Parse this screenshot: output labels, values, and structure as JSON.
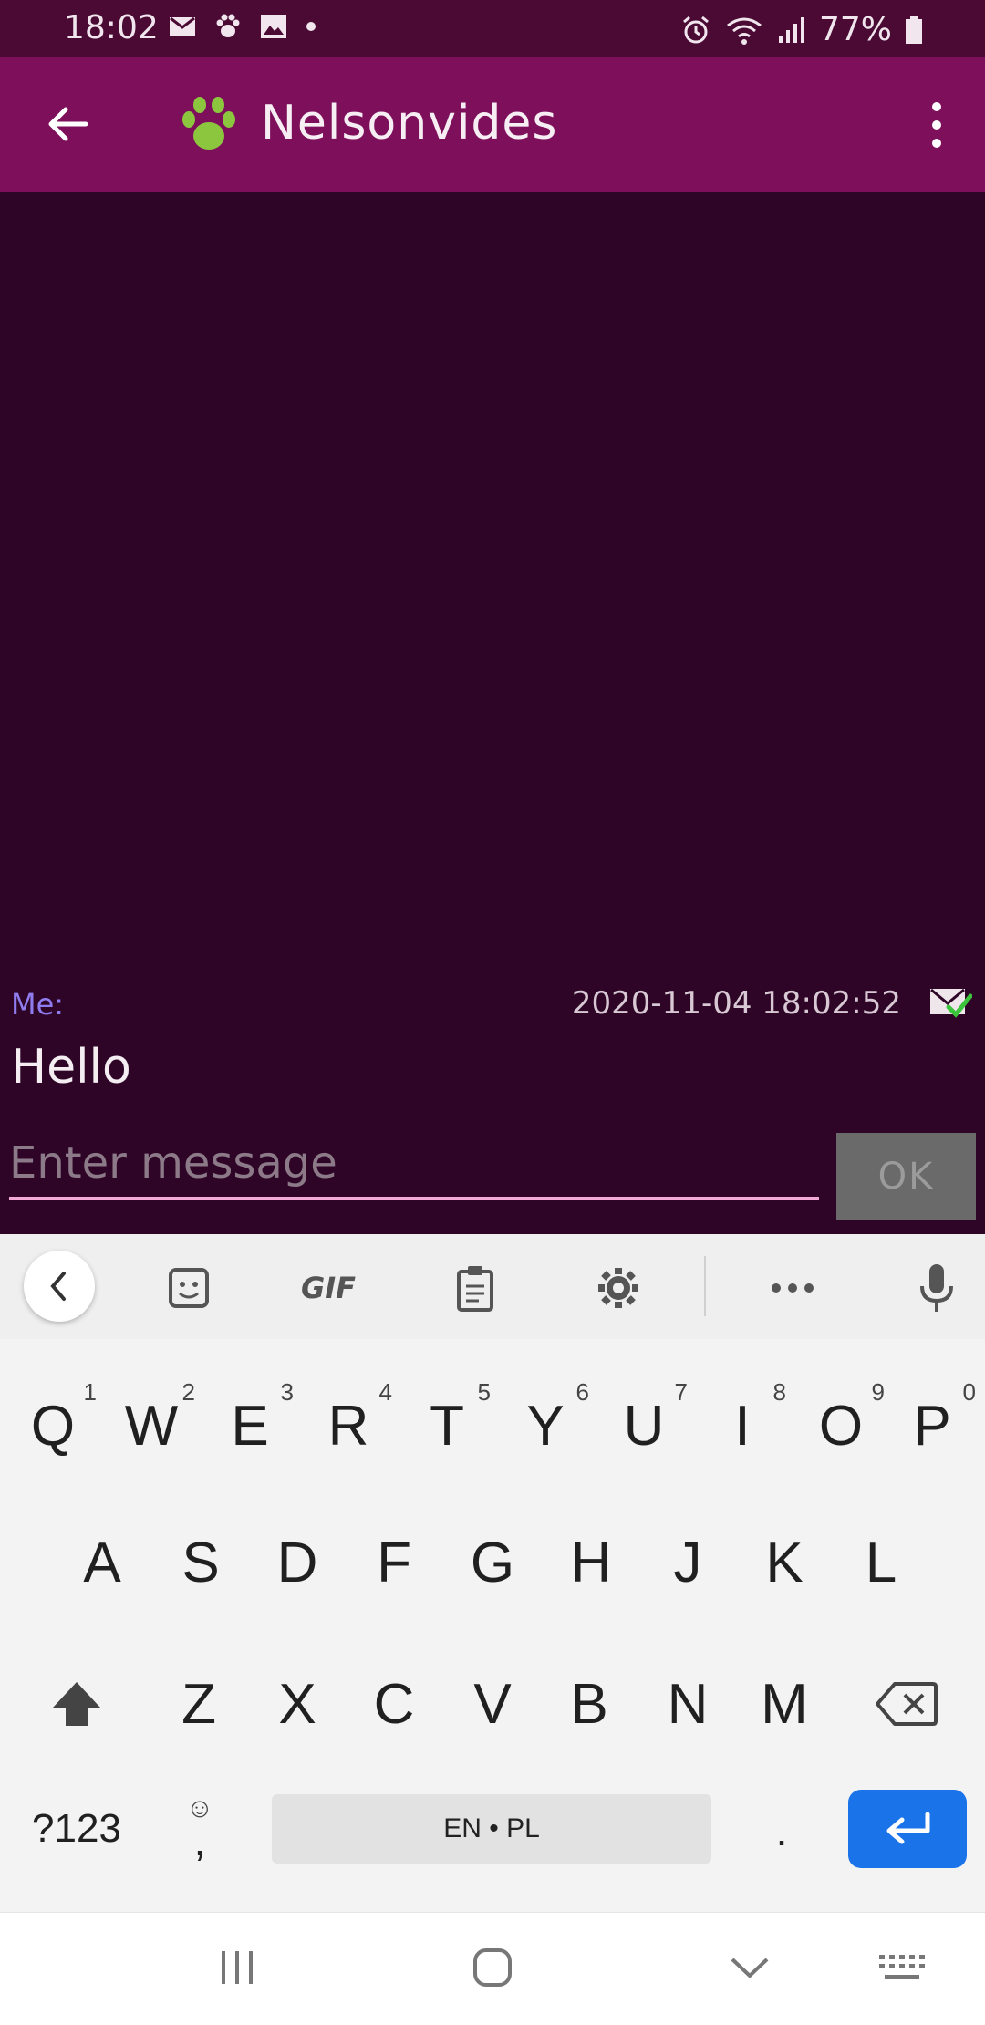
{
  "status_bar": {
    "time": "18:02",
    "battery": "77%",
    "notification_icons": [
      "mail-icon",
      "paw-icon",
      "image-icon",
      "dot-icon"
    ],
    "system_icons": [
      "alarm-icon",
      "wifi-icon",
      "signal-icon",
      "battery-icon"
    ]
  },
  "app_bar": {
    "title": "Nelsonvides",
    "back_icon": "arrow-left-icon",
    "menu_icon": "more-vert-icon",
    "paw_color": "#8cc63f",
    "background": "#7d0f5b"
  },
  "chat": {
    "background": "#2e0527",
    "messages": [
      {
        "sender": "Me:",
        "timestamp": "2020-11-04 18:02:52",
        "text": "Hello",
        "status_icon": "mail-sent-check-icon"
      }
    ]
  },
  "composer": {
    "placeholder": "Enter message",
    "value": "",
    "send_label": "OK"
  },
  "keyboard": {
    "toolbar": [
      "collapse-icon",
      "sticker-icon",
      "gif-icon",
      "clipboard-icon",
      "settings-icon",
      "more-icon",
      "mic-icon"
    ],
    "gif_label": "GIF",
    "row1": [
      {
        "k": "Q",
        "h": "1"
      },
      {
        "k": "W",
        "h": "2"
      },
      {
        "k": "E",
        "h": "3"
      },
      {
        "k": "R",
        "h": "4"
      },
      {
        "k": "T",
        "h": "5"
      },
      {
        "k": "Y",
        "h": "6"
      },
      {
        "k": "U",
        "h": "7"
      },
      {
        "k": "I",
        "h": "8"
      },
      {
        "k": "O",
        "h": "9"
      },
      {
        "k": "P",
        "h": "0"
      }
    ],
    "row2": [
      "A",
      "S",
      "D",
      "F",
      "G",
      "H",
      "J",
      "K",
      "L"
    ],
    "row3": [
      "Z",
      "X",
      "C",
      "V",
      "B",
      "N",
      "M"
    ],
    "symbols_label": "?123",
    "comma_label": ",",
    "space_label": "EN • PL",
    "period_label": ".",
    "accent_color": "#1a73e8"
  },
  "nav_bar": {
    "buttons": [
      "recents-icon",
      "home-icon",
      "back-chevron-icon",
      "keyboard-icon"
    ]
  }
}
